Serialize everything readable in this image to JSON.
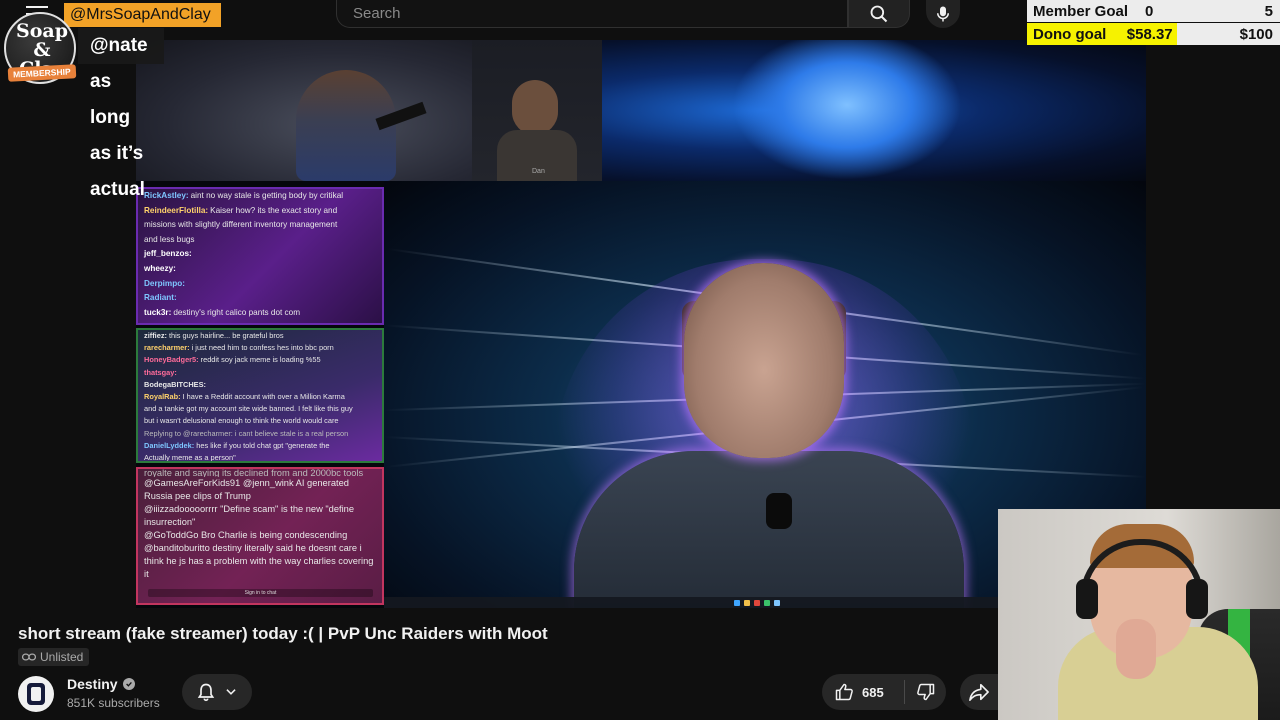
{
  "header": {
    "search_placeholder": "Search",
    "icons": [
      "menu-icon",
      "search-icon",
      "microphone-icon"
    ]
  },
  "goals": {
    "member": {
      "label": "Member Goal",
      "current": "0",
      "target": "5"
    },
    "dono": {
      "label": "Dono goal",
      "current": "$58.37",
      "target": "$100"
    },
    "colors": {
      "bar": "#ececec",
      "fill": "#f6f200"
    }
  },
  "alert": {
    "username": "@MrsSoapAndClay",
    "message": "@nate as long as it’s actual",
    "badge": "MEMBERSHIP",
    "logo_text": "Soap & Clay",
    "colors": {
      "name_bg": "#f2a227",
      "badge_bg": "#e8813a"
    }
  },
  "video": {
    "inset_label": "Dan",
    "chat_top": [
      {
        "user": "RickAstley:",
        "text": "aint no way stale is getting body by critikal",
        "color": "#7ec6ff"
      },
      {
        "user": "ReindeerFlotilla:",
        "text": "Kaiser how? its the exact story and",
        "color": "#ffd36b"
      },
      {
        "user": "",
        "text": "missions with slightly different inventory management",
        "color": "#ffffff"
      },
      {
        "user": "",
        "text": "and less bugs",
        "color": "#ffffff"
      },
      {
        "user": "jeff_benzos:",
        "text": "",
        "color": "#ffffff"
      },
      {
        "user": "wheezy:",
        "text": "",
        "color": "#ffffff"
      },
      {
        "user": "Derpimpo:",
        "text": "",
        "color": "#7ec6ff"
      },
      {
        "user": "Radiant:",
        "text": "",
        "color": "#7ec6ff"
      },
      {
        "user": "tuck3r:",
        "text": "destiny's right calico pants dot com",
        "color": "#ffffff"
      }
    ],
    "chat_mid": [
      {
        "user": "ziffiez:",
        "text": "this guys hairline... be grateful bros",
        "color": "#ffffff"
      },
      {
        "user": "rarecharmer:",
        "text": "i just need him to confess hes into bbc porn",
        "color": "#ffd36b"
      },
      {
        "user": "HoneyBadger5:",
        "text": "reddit soy jack meme is loading %55",
        "color": "#ff6b9a"
      },
      {
        "user": "thatsgay:",
        "text": "",
        "color": "#ff6b9a"
      },
      {
        "user": "BodegaBITCHES:",
        "text": "",
        "color": "#ffffff"
      },
      {
        "user": "RoyalRab:",
        "text": "I have a Reddit account with over a Million Karma",
        "color": "#ffd36b"
      },
      {
        "user": "",
        "text": "and a tankie got my account site wide banned. I felt like this guy",
        "color": "#ffffff"
      },
      {
        "user": "",
        "text": "but i wasn't delusional enough to think the world would care",
        "color": "#ffffff"
      },
      {
        "user": "",
        "text": "Replying to @rarecharmer: i cant believe stale is a real person",
        "color": "#bbbbbb"
      },
      {
        "user": "DanielLyddek:",
        "text": "hes like if you told chat gpt \"generate the",
        "color": "#7ec6ff"
      },
      {
        "user": "",
        "text": "Actually meme as a person\"",
        "color": "#ffffff"
      }
    ],
    "chat_bottom": [
      {
        "text": "royalte and saying its declined from and 2000bc tools"
      },
      {
        "text": "@GamesAreForKids91 @jenn_wink AI generated Russia pee clips of Trump"
      },
      {
        "text": "@iiizzadooooorrrr \"Define scam\" is the new \"define insurrection\""
      },
      {
        "text": "@GoToddGo Bro Charlie is being condescending"
      },
      {
        "text": "@banditoburitto destiny literally said he doesnt care i think he js has a problem with the way charlies covering it"
      }
    ],
    "chat_footer": "Sign in to chat"
  },
  "meta": {
    "title": "short stream (fake streamer) today :( | PvP Unc Raiders with Moot",
    "visibility": "Unlisted",
    "channel_name": "Destiny",
    "subscribers": "851K subscribers",
    "likes": "685",
    "icons": [
      "link-icon",
      "verified-icon",
      "bell-icon",
      "chevron-down-icon",
      "thumbs-up-icon",
      "thumbs-down-icon",
      "share-icon"
    ]
  }
}
